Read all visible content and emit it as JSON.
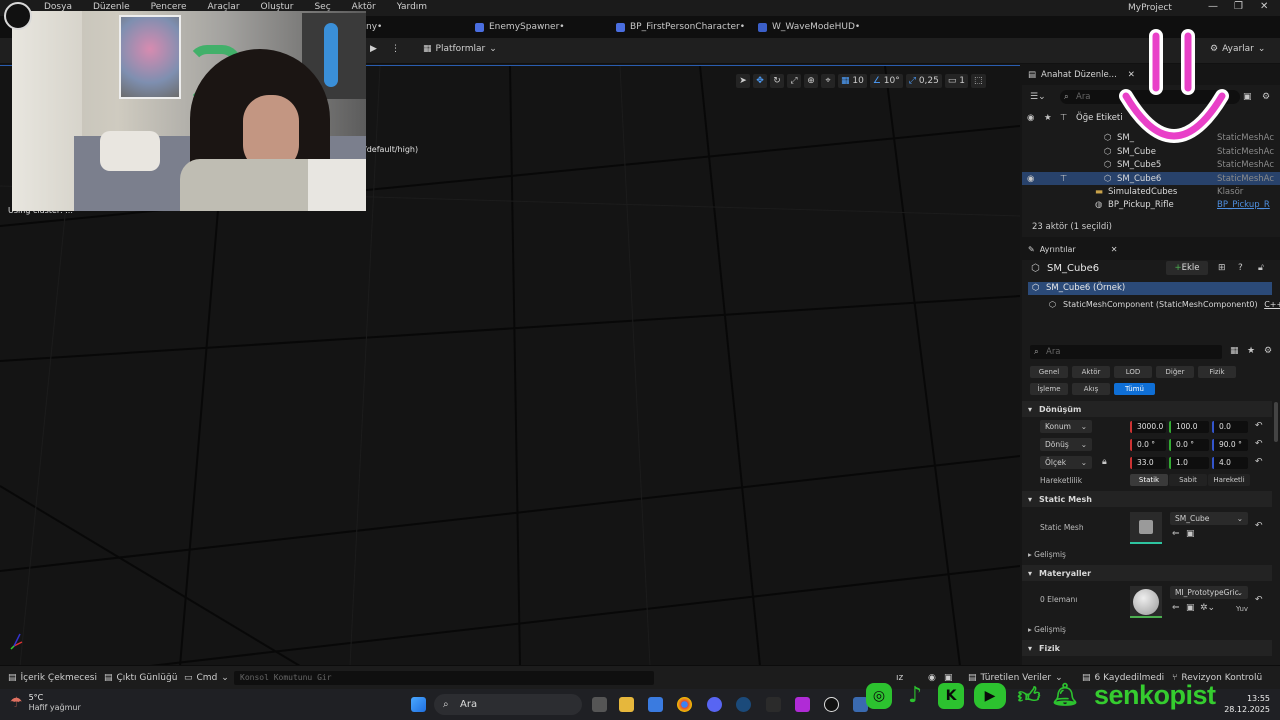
{
  "menu": [
    "Dosya",
    "Düzenle",
    "Pencere",
    "Araçlar",
    "Oluştur",
    "Seç",
    "Aktör",
    "Yardım"
  ],
  "project_name": "MyProject",
  "tabs": [
    {
      "label": "EnemySpawner•"
    },
    {
      "label": "BP_FirstPersonCharacter•"
    },
    {
      "label": "W_WaveModeHUD•"
    }
  ],
  "tab_partial": "ny•",
  "toolbar": {
    "platforms": "Platformlar",
    "settings": "Ayarlar"
  },
  "viewport": {
    "grid_snap": "10",
    "rot_snap": "10°",
    "scale_snap": "0,25",
    "camera_speed": "1",
    "stat_line": "/default/high)",
    "stat_partial": "Using cluster: ..."
  },
  "outliner": {
    "title": "Anahat Düzenle...",
    "search_placeholder": "Ara",
    "col_label": "Öğe Etiketi",
    "rows": [
      {
        "name": "SM_",
        "type": "StaticMeshAc"
      },
      {
        "name": "SM_Cube",
        "type": "StaticMeshAc"
      },
      {
        "name": "SM_Cube5",
        "type": "StaticMeshAc"
      },
      {
        "name": "SM_Cube6",
        "type": "StaticMeshAc"
      },
      {
        "name": "SimulatedCubes",
        "type": "Klasör"
      },
      {
        "name": "BP_Pickup_Rifle",
        "type": "BP_Pickup_R"
      }
    ],
    "count": "23 aktör (1 seçildi)"
  },
  "details": {
    "title": "Ayrıntılar",
    "actor": "SM_Cube6",
    "add": "Ekle",
    "instance": "SM_Cube6 (Örnek)",
    "component": "StaticMeshComponent (StaticMeshComponent0)",
    "component_suffix": "C++",
    "search_placeholder": "Ara",
    "filters_row1": [
      "Genel",
      "Aktör",
      "LOD",
      "Diğer",
      "Fizik"
    ],
    "filters_row2": [
      "İşleme",
      "Akış",
      "Tümü"
    ],
    "transform_header": "Dönüşüm",
    "location_label": "Konum",
    "location": [
      "3000.0",
      "100.0",
      "0.0"
    ],
    "rotation_label": "Dönüş",
    "rotation": [
      "0.0 °",
      "0.0 °",
      "90.0 °"
    ],
    "scale_label": "Ölçek",
    "scale": [
      "33.0",
      "1.0",
      "4.0"
    ],
    "mobility_label": "Hareketlilik",
    "mobility": [
      "Statik",
      "Sabit",
      "Hareketli"
    ],
    "static_mesh_header": "Static Mesh",
    "static_mesh_label": "Static Mesh",
    "static_mesh_value": "SM_Cube",
    "advanced": "Gelişmiş",
    "materials_header": "Materyaller",
    "element_label": "0 Elemanı",
    "material_value": "MI_PrototypeGric",
    "material_suffix": "Yuv",
    "advanced2": "Gelişmiş",
    "physics_header": "Fizik"
  },
  "bottombar": {
    "content_drawer": "İçerik Çekmecesi",
    "output_log": "Çıktı Günlüğü",
    "cmd": "Cmd",
    "console_placeholder": "Konsol Komutunu Gir",
    "derived_data": "Türetilen Veriler",
    "unsaved": "6 Kaydedilmedi",
    "revision": "Revizyon Kontrolü",
    "partial": "ız"
  },
  "taskbar": {
    "temp": "5°C",
    "weather": "Hafif yağmur",
    "search": "Ara",
    "time": "13:55",
    "date": "28.12.2025"
  },
  "overlay": {
    "brand": "senkopist"
  }
}
